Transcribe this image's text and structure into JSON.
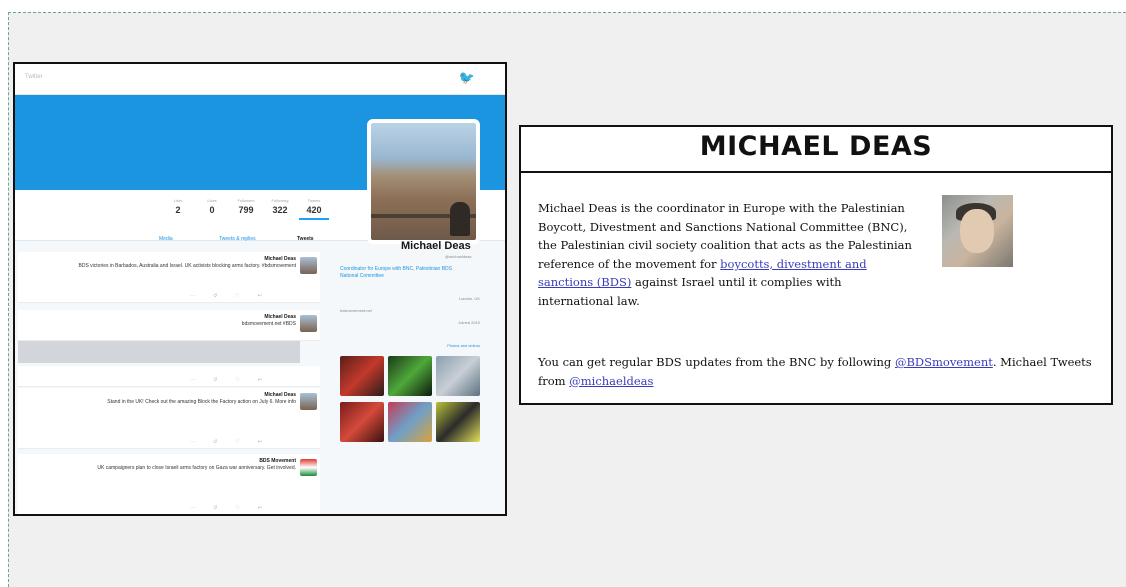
{
  "twitter": {
    "nav": {
      "left_text": "Twitter"
    },
    "bird_icon": "twitter-bird-icon",
    "stats": [
      {
        "label": "Tweets",
        "value": "420"
      },
      {
        "label": "Following",
        "value": "322"
      },
      {
        "label": "Followers",
        "value": "799"
      },
      {
        "label": "Likes",
        "value": "0"
      },
      {
        "label": "Lists",
        "value": "2"
      }
    ],
    "profile": {
      "name": "Michael Deas",
      "handle": "@michaeldeas",
      "bio": "Coordinator for Europe with BNC, Palestinian BDS National Committee",
      "side_lines": [
        "London, UK",
        "bdsmovement.net",
        "Joined 2010"
      ],
      "photos_label": "Photos and videos"
    },
    "tabs": [
      "Tweets",
      "Tweets & replies",
      "Media"
    ],
    "tweets": [
      {
        "author": "Michael Deas",
        "text": "BDS victories in Barbados, Australia and Israel. UK activists blocking arms factory. #bdsmovement"
      },
      {
        "author": "Michael Deas",
        "text": "bdsmovement.net #BDS"
      },
      {
        "author": "Michael Deas",
        "text": "Stand in the UK! Check out the amazing Block the Factory action on July 6. More info"
      },
      {
        "author": "BDS Movement",
        "text": "UK campaigners plan to close Israeli arms factory on Gaza war anniversary. Get involved."
      }
    ]
  },
  "article": {
    "title": "MICHAEL DEAS",
    "bio_parts": {
      "before_link": "Michael Deas is the coordinator in Europe with the Palestinian Boycott, Divestment and Sanctions National Committee (BNC), the Palestinian civil society coalition that acts as the Palestinian reference of the movement for ",
      "link": "boycotts, divestment and sanctions (BDS)",
      "after_link": " against Israel until it complies with international law."
    },
    "follow_parts": {
      "before": "You can get regular BDS updates from the BNC by following ",
      "link1": "@BDSmovement",
      "middle": ". Michael Tweets from ",
      "link2": "@michaeldeas"
    }
  }
}
